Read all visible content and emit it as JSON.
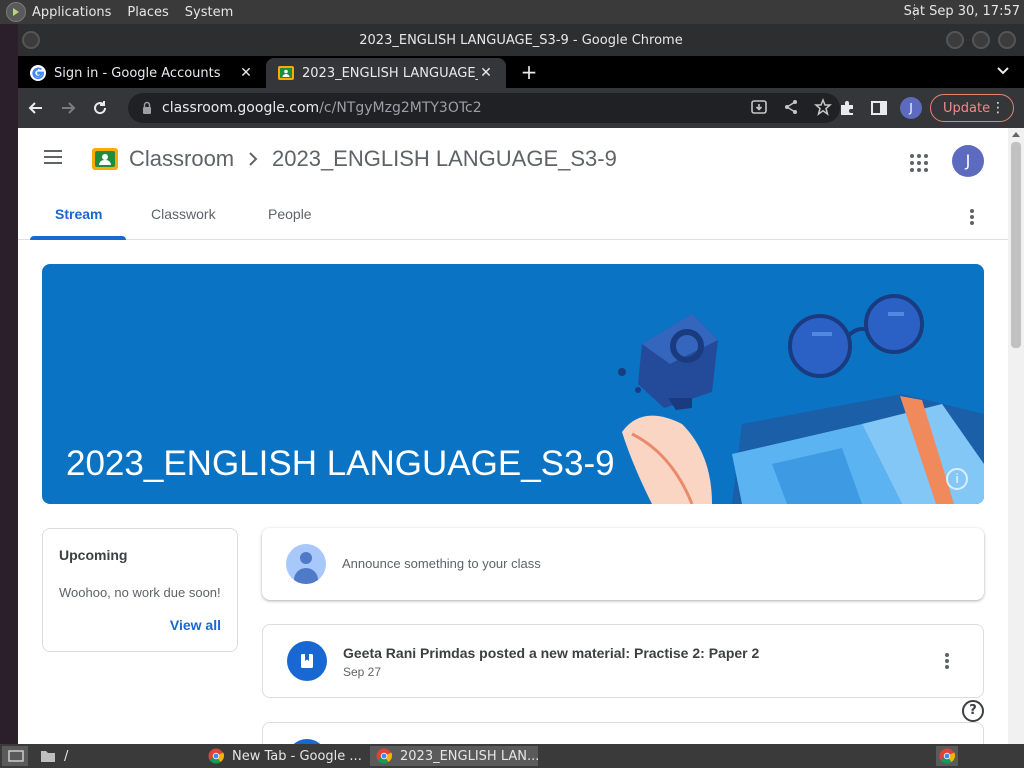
{
  "os": {
    "menus": [
      "Applications",
      "Places",
      "System"
    ],
    "clock": "Sat Sep 30, 17:57"
  },
  "window": {
    "title": "2023_ENGLISH LANGUAGE_S3-9 - Google Chrome"
  },
  "browser": {
    "tabs": [
      {
        "label": "Sign in - Google Accounts",
        "icon": "google-icon"
      },
      {
        "label": "2023_ENGLISH LANGUAGE_S3-9",
        "icon": "classroom-icon"
      }
    ],
    "url_host": "classroom.google.com",
    "url_path": "/c/NTgyMzg2MTY3OTc2",
    "update_label": "Update",
    "profile_initial": "J"
  },
  "classroom": {
    "brand": "Classroom",
    "course": "2023_ENGLISH LANGUAGE_S3-9",
    "user_initial": "J",
    "tabs": [
      "Stream",
      "Classwork",
      "People"
    ],
    "banner_title": "2023_ENGLISH LANGUAGE_S3-9",
    "upcoming": {
      "title": "Upcoming",
      "text": "Woohoo, no work due soon!",
      "link": "View all"
    },
    "announce_placeholder": "Announce something to your class",
    "posts": [
      {
        "title": "Geeta Rani Primdas posted a new material: Practise 2: Paper 2",
        "date": "Sep 27"
      }
    ]
  },
  "taskbar": {
    "items": [
      {
        "label": "/",
        "icon": "folder-icon"
      },
      {
        "label": "New Tab - Google ...",
        "icon": "chrome-icon"
      },
      {
        "label": "2023_ENGLISH LAN...",
        "icon": "chrome-icon"
      }
    ]
  },
  "colors": {
    "accent": "#1967d2",
    "banner": "#0b73c4",
    "avatar": "#5c6bc0"
  }
}
